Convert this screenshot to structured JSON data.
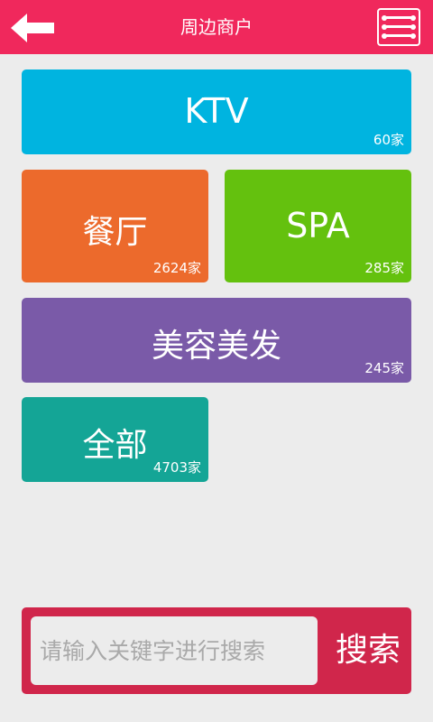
{
  "header": {
    "title": "周边商户",
    "back_icon": "arrow-left-icon",
    "menu_icon": "menu-list-icon",
    "background": "#f0285c"
  },
  "categories": [
    {
      "label": "KTV",
      "count": "60家",
      "color": "#00b4e0"
    },
    {
      "label": "餐厅",
      "count": "2624家",
      "color": "#ec6a2c"
    },
    {
      "label": "SPA",
      "count": "285家",
      "color": "#64c10e"
    },
    {
      "label": "美容美发",
      "count": "245家",
      "color": "#7a5aa8"
    },
    {
      "label": "全部",
      "count": "4703家",
      "color": "#14a596"
    }
  ],
  "search": {
    "placeholder": "请输入关键字进行搜索",
    "button_label": "搜索",
    "color": "#d0264b"
  }
}
